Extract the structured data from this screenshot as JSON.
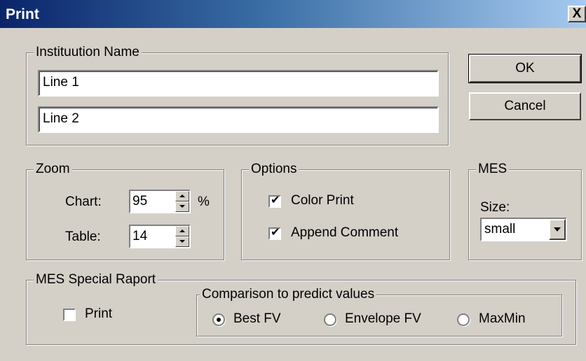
{
  "window": {
    "title": "Print",
    "close_glyph": "X"
  },
  "institution": {
    "legend": "Instituution Name",
    "line1": "Line 1",
    "line2": "Line 2"
  },
  "buttons": {
    "ok": "OK",
    "cancel": "Cancel"
  },
  "zoom": {
    "legend": "Zoom",
    "chart_label": "Chart:",
    "chart_value": "95",
    "chart_unit": "%",
    "table_label": "Table:",
    "table_value": "14"
  },
  "options": {
    "legend": "Options",
    "color_print": {
      "label": "Color Print",
      "checked": true
    },
    "append_comment": {
      "label": "Append Comment",
      "checked": true
    }
  },
  "mes": {
    "legend": "MES",
    "size_label": "Size:",
    "size_value": "small"
  },
  "special": {
    "legend": "MES Special Raport",
    "print": {
      "label": "Print",
      "checked": false
    },
    "comparison": {
      "legend": "Comparison to predict values",
      "options": [
        {
          "label": "Best FV",
          "selected": true
        },
        {
          "label": "Envelope FV",
          "selected": false
        },
        {
          "label": "MaxMin",
          "selected": false
        }
      ]
    }
  },
  "check_glyph": "✔"
}
